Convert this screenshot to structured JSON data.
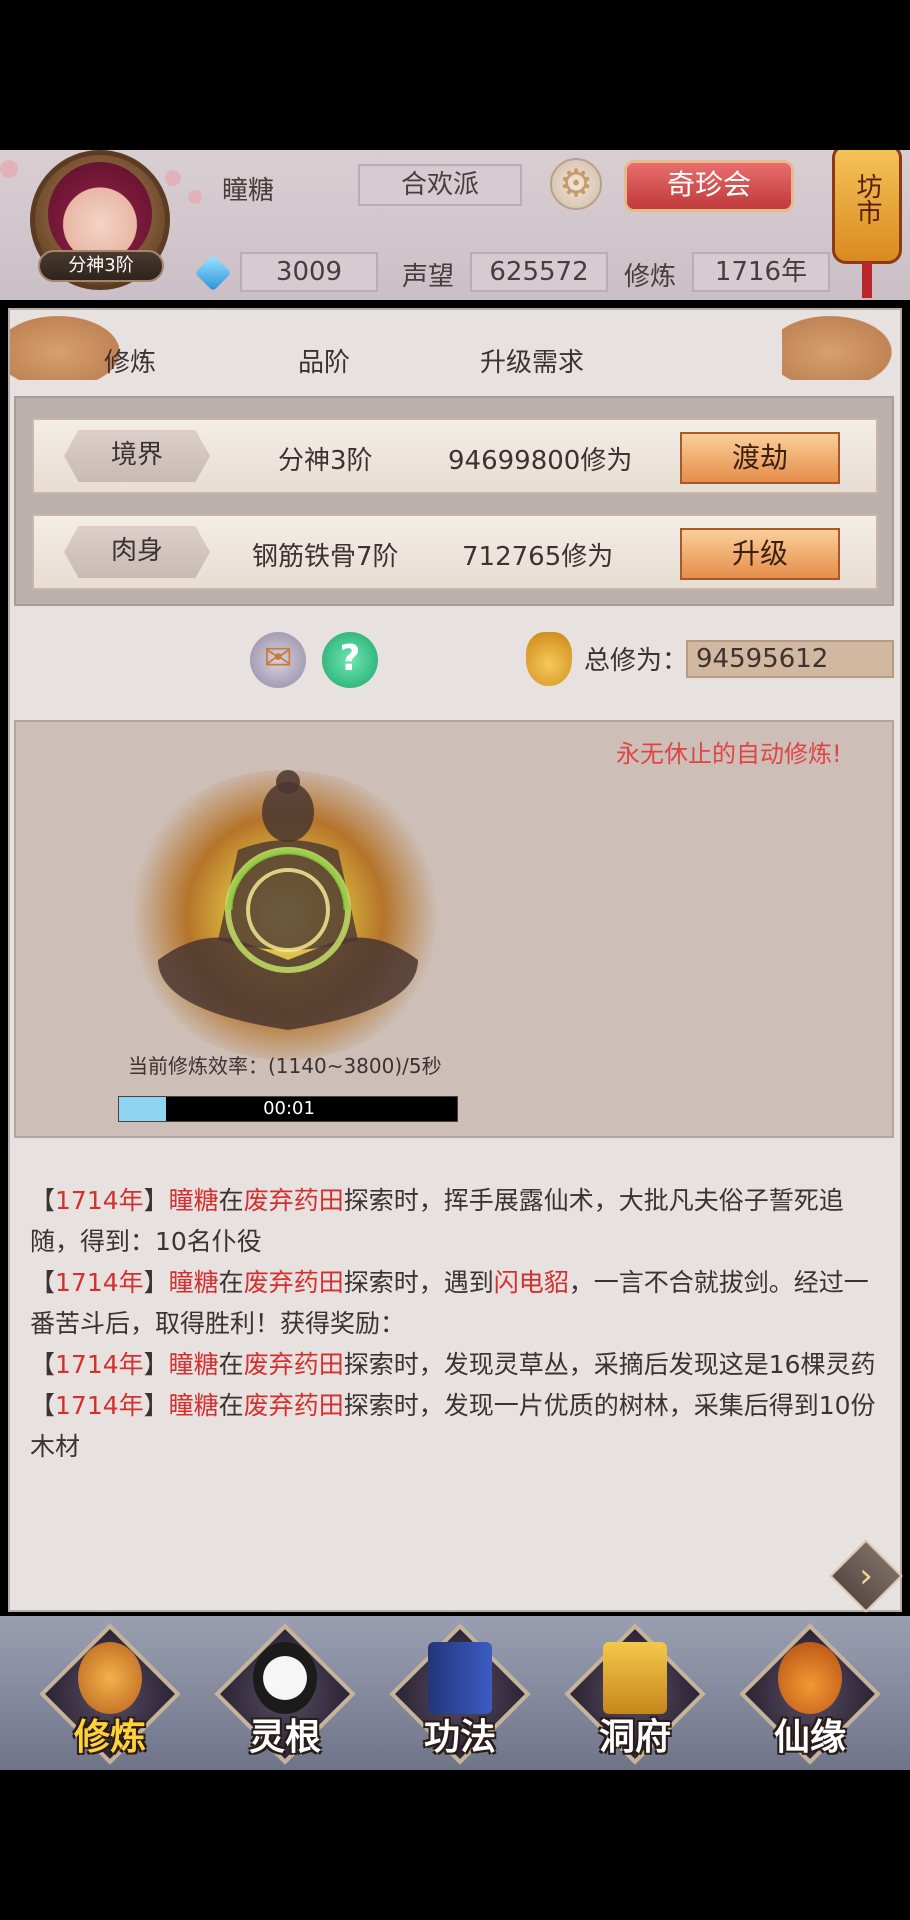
{
  "header": {
    "player_name": "瞳糖",
    "rank": "分神3阶",
    "sect": "合欢派",
    "treasure_button": "奇珍会",
    "market_label": "坊市",
    "gems": "3009",
    "prestige_label": "声望",
    "prestige_value": "625572",
    "cultivation_label": "修炼",
    "cultivation_years": "1716年"
  },
  "columns": [
    "修炼",
    "品阶",
    "升级需求"
  ],
  "rows": [
    {
      "tag": "境界",
      "grade": "分神3阶",
      "requirement": "94699800修为",
      "button": "渡劫"
    },
    {
      "tag": "肉身",
      "grade": "钢筋铁骨7阶",
      "requirement": "712765修为",
      "button": "升级"
    }
  ],
  "total": {
    "label": "总修为：",
    "value": "94595612"
  },
  "training": {
    "slogan": "永无休止的自动修炼!",
    "rate_text": "当前修炼效率：(1140~3800)/5秒",
    "progress_time": "00:01",
    "progress_fraction": 0.14
  },
  "log": [
    {
      "year": "1714年",
      "name": "瞳糖",
      "place": "废弃药田",
      "text1": "探索时，挥手展露仙术，大批凡夫俗子誓死追随，得到：10名仆役"
    },
    {
      "year": "1714年",
      "name": "瞳糖",
      "place": "废弃药田",
      "text1": "探索时，遇到",
      "enemy": "闪电貂",
      "text2": "，一言不合就拔剑。经过一番苦斗后，取得胜利！获得奖励："
    },
    {
      "year": "1714年",
      "name": "瞳糖",
      "place": "废弃药田",
      "text1": "探索时，发现灵草丛，采摘后发现这是16棵灵药"
    },
    {
      "year": "1714年",
      "name": "瞳糖",
      "place": "废弃药田",
      "text1": "探索时，发现一片优质的树林，采集后得到10份木材"
    }
  ],
  "nav": [
    {
      "label": "修炼",
      "icon": "cultivation-icon",
      "active": true
    },
    {
      "label": "灵根",
      "icon": "spirit-root-icon",
      "active": false
    },
    {
      "label": "功法",
      "icon": "technique-book-icon",
      "active": false
    },
    {
      "label": "洞府",
      "icon": "cave-residence-icon",
      "active": false
    },
    {
      "label": "仙缘",
      "icon": "gourd-icon",
      "active": false
    }
  ],
  "colors": {
    "accent_red": "#d3302f",
    "button_orange": "#e58d4a",
    "active_nav": "#ffd13a"
  }
}
